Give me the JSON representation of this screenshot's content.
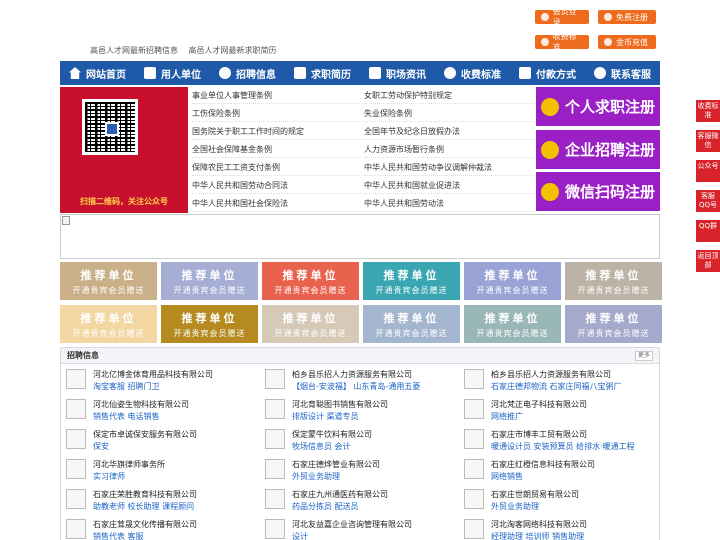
{
  "top": {
    "links": [
      "高邑人才网最新招聘信息",
      "高邑人才网最新求职简历"
    ],
    "buttons": {
      "login": "会员登录",
      "register": "免费注册",
      "fee": "收费标准",
      "coin": "金币充值"
    }
  },
  "nav": [
    "网站首页",
    "用人单位",
    "招聘信息",
    "求职简历",
    "职场资讯",
    "收费标准",
    "付款方式",
    "联系客服"
  ],
  "banner": {
    "qr_caption": "扫描二维码，关注公众号",
    "laws_left": [
      "事业单位人事管理条例",
      "工伤保险条例",
      "国务院关于职工工作时间的规定",
      "全国社会保障基金条例",
      "保障农民工工资支付条例",
      "中华人民共和国劳动合同法",
      "中华人民共和国社会保险法"
    ],
    "laws_right": [
      "女职工劳动保护特别规定",
      "失业保险条例",
      "全国年节及纪念日放假办法",
      "人力资源市场暂行条例",
      "中华人民共和国劳动争议调解仲裁法",
      "中华人民共和国就业促进法",
      "中华人民共和国劳动法"
    ],
    "register": [
      "个人求职注册",
      "企业招聘注册",
      "微信扫码注册"
    ]
  },
  "recommend": {
    "title": "推荐单位",
    "subtitle": "开通贵宾会员赠送",
    "colors": [
      "#c9b089",
      "#a6aed6",
      "#e9624e",
      "#3aa6b2",
      "#9aa3d6",
      "#bcb2a5",
      "#f3d7a3",
      "#b58a1f",
      "#d7c9b7",
      "#a4b6cf",
      "#9ab7b8",
      "#a5a9cc"
    ]
  },
  "jobs": {
    "title": "招聘信息",
    "more": "更多",
    "items": [
      {
        "company": "河北亿博金体育用品科技有限公司",
        "positions": "淘宝客服  招聘门卫"
      },
      {
        "company": "柏乡县乐招人力资源服务有限公司",
        "positions": "【烟台-安波福】 山东青岛-通用五菱"
      },
      {
        "company": "柏乡县乐招人力资源服务有限公司",
        "positions": "石家庄德邦物流  石家庄同福八宝粥厂"
      },
      {
        "company": "河北仙姿生物科技有限公司",
        "positions": "销售代表  电话销售"
      },
      {
        "company": "河北育聪图书销售有限公司",
        "positions": "排版设计  渠道专员"
      },
      {
        "company": "河北梵正电子科技有限公司",
        "positions": "网络推广"
      },
      {
        "company": "保定市卓诚保安服务有限公司",
        "positions": "保安"
      },
      {
        "company": "保定蒙牛饮料有限公司",
        "positions": "牧场信息员  会计"
      },
      {
        "company": "石家庄市博丰工贸有限公司",
        "positions": "暖通设计员  安装预算员  给排水·暖通工程"
      },
      {
        "company": "河北华旗律师事务所",
        "positions": "实习律师"
      },
      {
        "company": "石家庄德烨管业有限公司",
        "positions": "外贸业务助理"
      },
      {
        "company": "石家庄红橙信息科技有限公司",
        "positions": "网络销售"
      },
      {
        "company": "石家庄荣胜教育科技有限公司",
        "positions": "助教老师  校长助理  课程顾问"
      },
      {
        "company": "石家庄九州通医药有限公司",
        "positions": "药品分拣员  配送员"
      },
      {
        "company": "石家庄世朗贸易有限公司",
        "positions": "外贸业务助理"
      },
      {
        "company": "石家庄茸晟文化传播有限公司",
        "positions": "销售代表  客服"
      },
      {
        "company": "河北友益嘉企业咨询管理有限公司",
        "positions": "设计"
      },
      {
        "company": "河北淘客网络科技有限公司",
        "positions": "经理助理  培训师  销售助理"
      }
    ]
  },
  "side": [
    "收费标准",
    "客服微信",
    "公众号",
    "客服QQ号",
    "QQ群",
    "返回顶部"
  ]
}
